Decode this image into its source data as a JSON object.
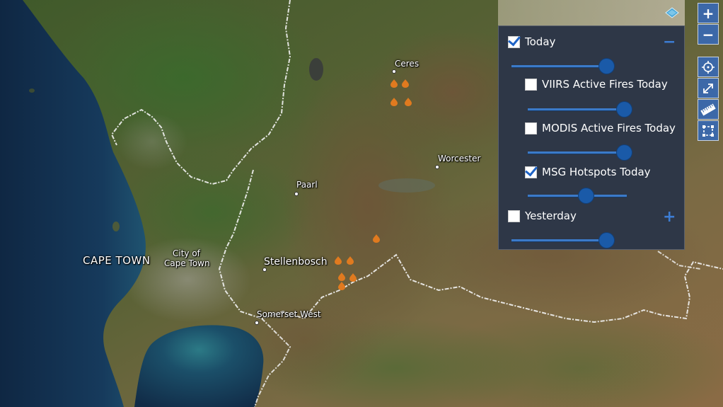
{
  "places": {
    "cape_town": "CAPE TOWN",
    "city_of_cape_town_1": "City of",
    "city_of_cape_town_2": "Cape Town",
    "stellenbosch": "Stellenbosch",
    "paarl": "Paarl",
    "ceres": "Ceres",
    "worcester": "Worcester",
    "somerset_west": "Somerset West"
  },
  "layers": {
    "today": {
      "label": "Today",
      "checked": true,
      "expanded": true,
      "opacity": 0.85
    },
    "viirs": {
      "label": "VIIRS Active Fires Today",
      "checked": false,
      "opacity": 0.85
    },
    "modis": {
      "label": "MODIS Active Fires Today",
      "checked": false,
      "opacity": 0.85
    },
    "msg": {
      "label": "MSG Hotspots Today",
      "checked": true,
      "opacity": 0.59
    },
    "yesterday": {
      "label": "Yesterday",
      "checked": false,
      "expanded": false,
      "opacity": 0.85
    }
  },
  "toolbar": {
    "zoom_in": "+",
    "zoom_out": "−"
  },
  "colors": {
    "panel_bg": "#2e3747",
    "accent_blue": "#3d7dd4",
    "slider_thumb": "#1a5aa8",
    "toolbar_bg": "#3c68a8",
    "fire_marker": "#e07a1f",
    "boundary": "#f2f2f2"
  }
}
